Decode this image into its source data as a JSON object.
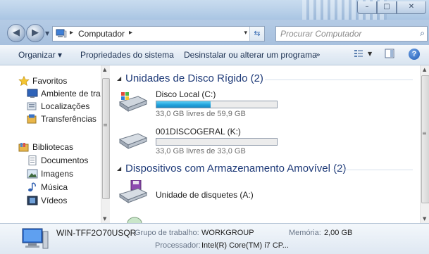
{
  "window": {
    "minimize_glyph": "–",
    "maximize_glyph": "□",
    "close_glyph": "✕"
  },
  "nav": {
    "back_icon": "◀",
    "forward_icon": "▶",
    "history_dropdown_icon": "▼",
    "address_separator": "▸",
    "address_crumb": "Computador",
    "address_dropdown_icon": "▾",
    "refresh_icon": "⇆",
    "search_placeholder": "Procurar Computador",
    "search_icon": "⌕"
  },
  "toolbar": {
    "organize_label": "Organizar ▾",
    "properties_label": "Propriedades do sistema",
    "uninstall_label": "Desinstalar ou alterar um programa",
    "more_label": "»",
    "view_dropdown_icon": "▼",
    "help_label": "?"
  },
  "sidebar": {
    "items": [
      {
        "label": "Favoritos",
        "icon": "star-icon"
      },
      {
        "label": "Ambiente de trab",
        "icon": "desktop-icon"
      },
      {
        "label": "Localizações",
        "icon": "recent-places-icon"
      },
      {
        "label": "Transferências",
        "icon": "downloads-icon"
      },
      {
        "label": "Bibliotecas",
        "icon": "libraries-icon"
      },
      {
        "label": "Documentos",
        "icon": "documents-icon"
      },
      {
        "label": "Imagens",
        "icon": "pictures-icon"
      },
      {
        "label": "Música",
        "icon": "music-icon"
      },
      {
        "label": "Vídeos",
        "icon": "videos-icon"
      }
    ],
    "scroll_up": "▲",
    "scroll_down": "▼",
    "scroll_grip": "≡"
  },
  "content": {
    "collapse_icon": "◢",
    "groups": [
      {
        "title": "Unidades de Disco Rígido (2)"
      },
      {
        "title": "Dispositivos com Armazenamento Amovível (2)"
      }
    ],
    "drives": [
      {
        "name": "Disco Local (C:)",
        "free_text": "33,0 GB livres de 59,9 GB",
        "used_fraction": 0.449
      },
      {
        "name": "001DISCOGERAL (K:)",
        "free_text": "33,0 GB livres de 33,0 GB",
        "used_fraction": 0.0
      }
    ],
    "removable": [
      {
        "name": "Unidade de disquetes (A:)"
      }
    ],
    "scroll_up": "▲",
    "scroll_down": "▼",
    "scroll_grip": "≡"
  },
  "details": {
    "computer_name": "WIN-TFF2O70USQR",
    "workgroup_label": "Grupo de trabalho:",
    "workgroup_value": "WORKGROUP",
    "memory_label": "Memória:",
    "memory_value": "2,00 GB",
    "processor_label": "Processador:",
    "processor_value": "Intel(R) Core(TM) i7 CP..."
  },
  "colors": {
    "group_title": "#1e3a78",
    "usage_bar": "#22a2dc"
  }
}
